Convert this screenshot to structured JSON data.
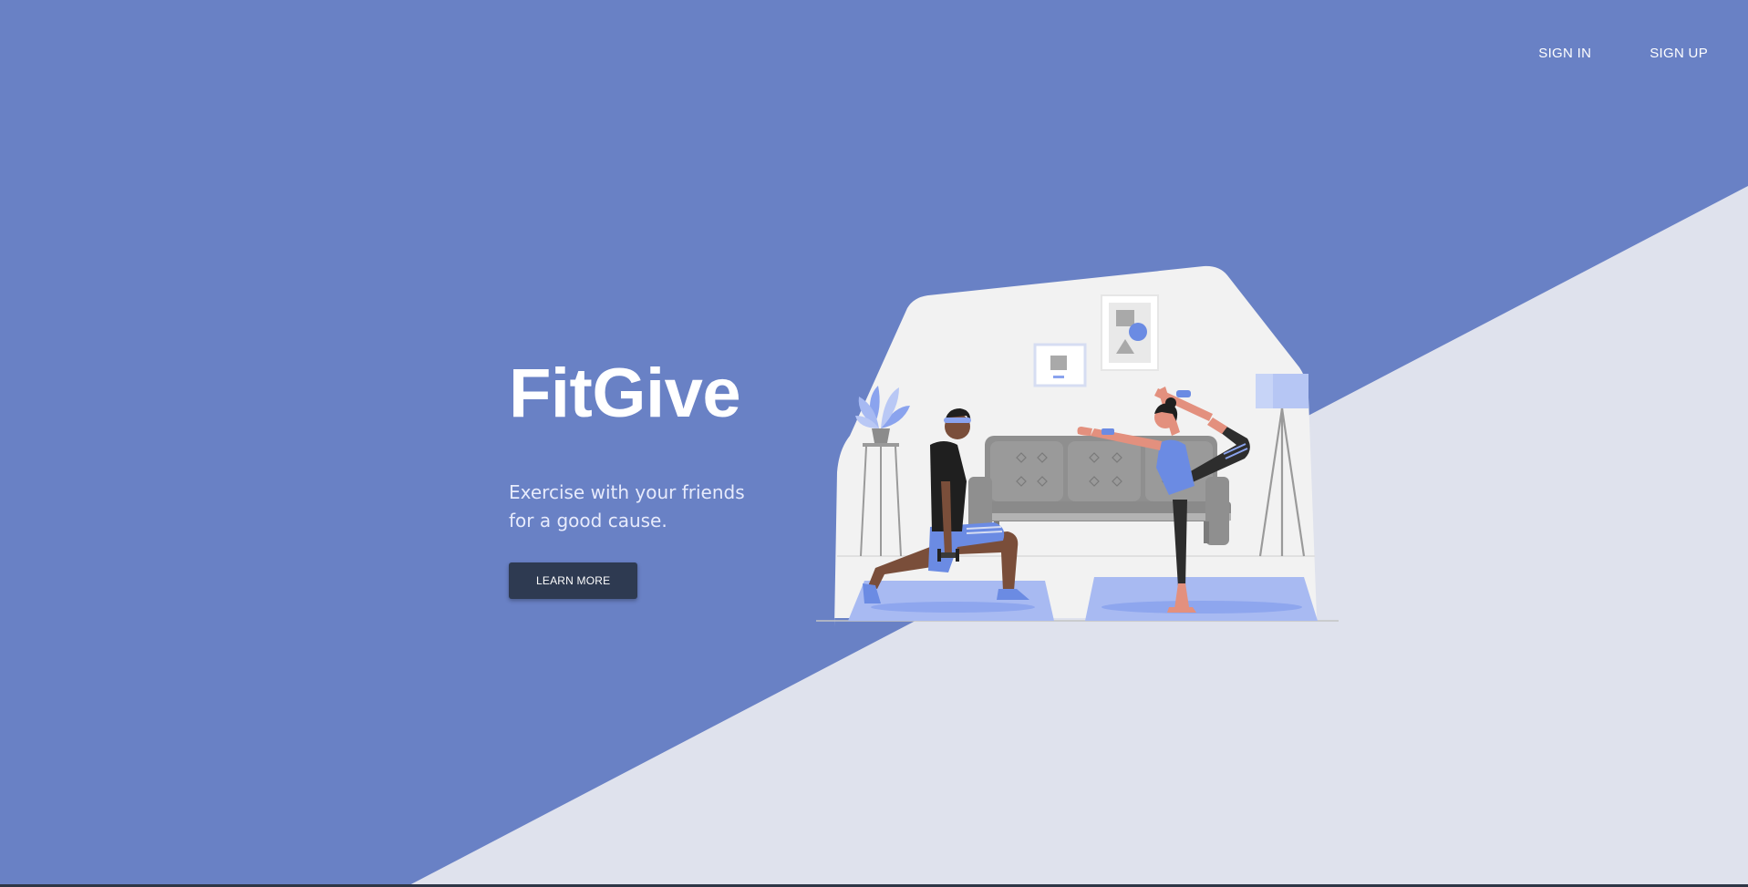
{
  "nav": {
    "sign_in_label": "SIGN IN",
    "sign_up_label": "SIGN UP"
  },
  "hero": {
    "title": "FitGive",
    "tagline_line1": "Exercise with your friends",
    "tagline_line2": "for a good cause.",
    "cta_label": "LEARN MORE"
  },
  "colors": {
    "primary_blue": "#6981c5",
    "light_gray": "#dfe2ed",
    "button_dark": "#2e3a51",
    "text_white": "#ffffff"
  },
  "illustration": {
    "subject": "workout-at-home-illustration"
  }
}
